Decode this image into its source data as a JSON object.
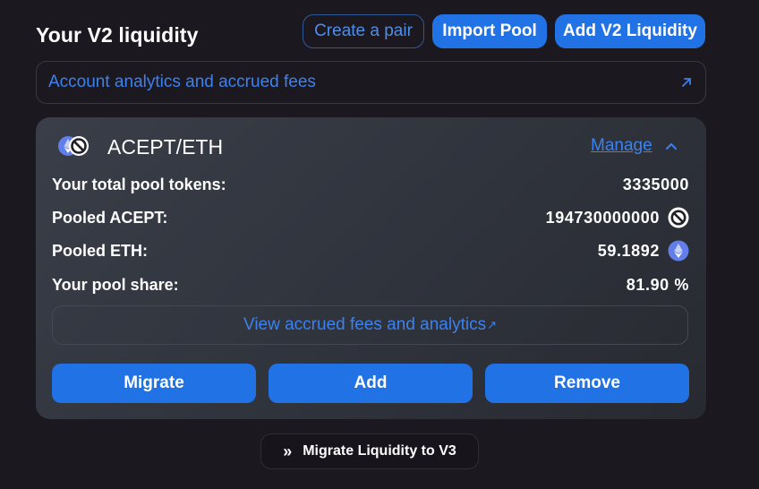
{
  "header": {
    "title": "Your V2 liquidity",
    "create_pair_label": "Create a pair",
    "import_pool_label": "Import Pool",
    "add_v2_label": "Add V2 Liquidity"
  },
  "banner": {
    "label": "Account analytics and accrued fees",
    "icon": "arrow-up-right-icon"
  },
  "pool": {
    "pair": "ACEPT/ETH",
    "manage_label": "Manage",
    "rows": [
      {
        "label": "Your total pool tokens:",
        "value": "3335000",
        "icon": ""
      },
      {
        "label": "Pooled ACEPT:",
        "value": "194730000000",
        "icon": "blocked-token-icon"
      },
      {
        "label": "Pooled ETH:",
        "value": "59.1892",
        "icon": "eth-icon"
      },
      {
        "label": "Your pool share:",
        "value": "81.90 %",
        "icon": ""
      }
    ],
    "view_fees_label": "View accrued fees and analytics",
    "view_fees_arrow": "↗",
    "migrate_label": "Migrate",
    "add_label": "Add",
    "remove_label": "Remove"
  },
  "footer": {
    "migrate_v3_label": "Migrate Liquidity to V3",
    "migrate_v3_glyph": "»"
  },
  "colors": {
    "background": "#1c1820",
    "accent": "#2172e5",
    "link": "#3b82f0",
    "card": "#33363f"
  }
}
